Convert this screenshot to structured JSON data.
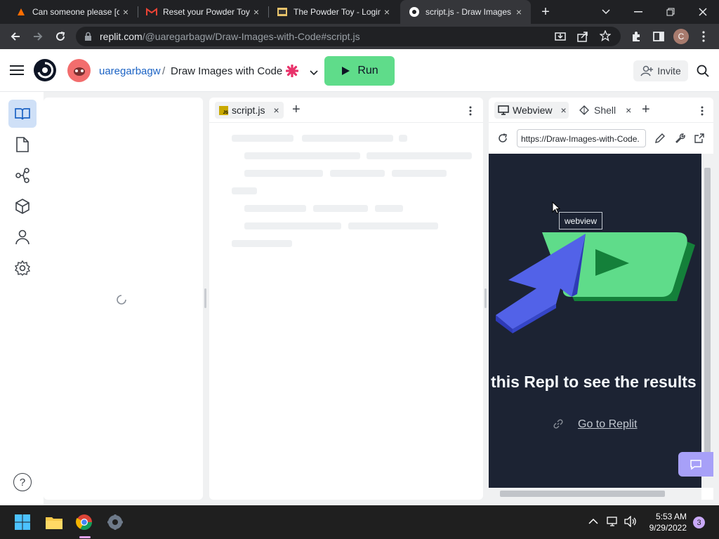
{
  "browser": {
    "tabs": [
      {
        "title": "Can someone please [c",
        "icon": "reddit-like-icon",
        "close": "×"
      },
      {
        "title": "Reset your Powder Toy",
        "icon": "gmail-icon",
        "close": "×"
      },
      {
        "title": "The Powder Toy - Login",
        "icon": "powder-toy-icon",
        "close": "×"
      },
      {
        "title": "script.js - Draw Images",
        "icon": "replit-icon",
        "close": "×"
      }
    ],
    "new_tab": "+",
    "url_host": "replit.com",
    "url_path": "/@uaregarbagw/Draw-Images-with-Code#script.js",
    "profile_initial": "C"
  },
  "header": {
    "username": "uaregarbagw",
    "separator": "/",
    "repl_name": "Draw Images with Code",
    "run_label": "Run",
    "invite_label": "Invite"
  },
  "editor": {
    "tab_label": "script.js",
    "tab_badge": "JS",
    "close": "×",
    "add": "+"
  },
  "webview": {
    "tabs": [
      {
        "label": "Webview",
        "close": "×"
      },
      {
        "label": "Shell",
        "close": "×"
      }
    ],
    "add": "+",
    "url": "https://Draw-Images-with-Code.",
    "tooltip": "webview",
    "message": "this Repl to see the results h",
    "link_label": "Go to Replit"
  },
  "sidebar": {
    "help": "?"
  },
  "taskbar": {
    "time": "5:53 AM",
    "date": "9/29/2022",
    "notification_count": "3"
  },
  "colors": {
    "run_green": "#5fdc8a",
    "webview_bg": "#1c2333",
    "accent_blue": "#1c63c4"
  }
}
